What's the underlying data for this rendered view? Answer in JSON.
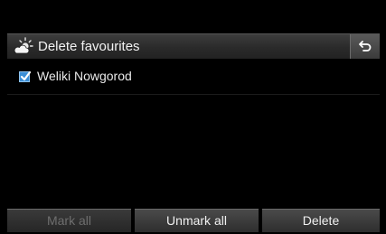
{
  "header": {
    "title": "Delete favourites",
    "title_icon": "weather-sun-cloud-icon",
    "back_icon": "back-arrow-icon"
  },
  "favourites": [
    {
      "label": "Weliki Nowgorod",
      "checked": true
    }
  ],
  "buttons": {
    "mark_all": "Mark all",
    "unmark_all": "Unmark all",
    "delete": "Delete"
  },
  "colors": {
    "checkbox": "#3c8fd6",
    "disabled_text": "#6e6e6e"
  }
}
